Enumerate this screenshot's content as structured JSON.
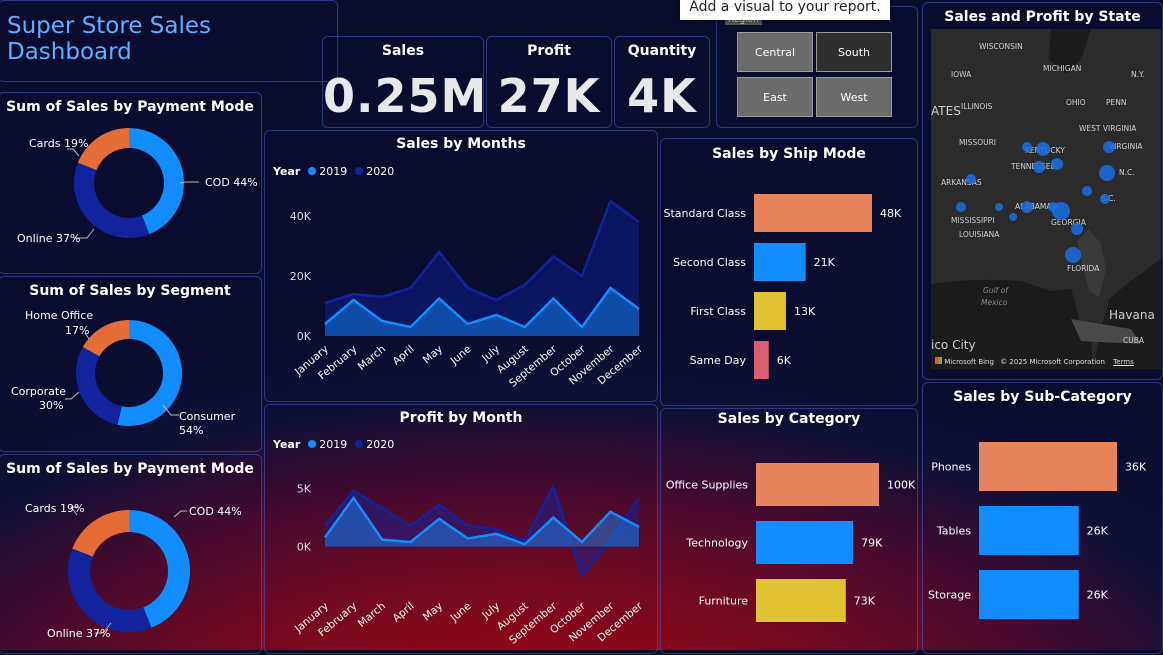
{
  "header": {
    "title": "Super Store Sales Dashboard"
  },
  "tooltip": {
    "text": "Add a visual to your report."
  },
  "kpis": {
    "sales": {
      "label": "Sales",
      "value": "0.25M"
    },
    "profit": {
      "label": "Profit",
      "value": "27K"
    },
    "quantity": {
      "label": "Quantity",
      "value": "4K"
    }
  },
  "region_slicer": {
    "title": "Region",
    "options": [
      "Central",
      "South",
      "East",
      "West"
    ],
    "selected": "South"
  },
  "payment_donut_1": {
    "title": "Sum of Sales by Payment Mode",
    "labels": [
      "Cards 19%",
      "COD 44%",
      "Online 37%"
    ]
  },
  "segment_donut": {
    "title": "Sum of Sales by Segment",
    "label_home": "Home Office",
    "label_home_pct": "17%",
    "label_corp": "Corporate",
    "label_corp_pct": "30%",
    "label_cons": "Consumer",
    "label_cons_pct": "54%"
  },
  "payment_donut_2": {
    "title": "Sum of Sales by Payment Mode",
    "labels": [
      "Cards 19%",
      "COD 44%",
      "Online 37%"
    ]
  },
  "sales_by_months": {
    "title": "Sales by Months",
    "legend_title": "Year",
    "y_ticks": [
      "40K",
      "20K",
      "0K"
    ]
  },
  "profit_by_month": {
    "title": "Profit by Month",
    "legend_title": "Year",
    "y_ticks": [
      "5K",
      "0K"
    ]
  },
  "ship_mode": {
    "title": "Sales by Ship Mode"
  },
  "category": {
    "title": "Sales by Category"
  },
  "sub_category": {
    "title": "Sales by Sub-Category"
  },
  "map": {
    "title": "Sales and Profit by State",
    "attribution": "© 2025 Microsoft Corporation",
    "terms": "Terms",
    "bing": "Microsoft Bing",
    "place_labels": [
      "WISCONSIN",
      "MICHIGAN",
      "IOWA",
      "N.Y.",
      "ILLINOIS",
      "OHIO",
      "PENN",
      "ATES",
      "MISSOURI",
      "KENTUCKY",
      "WEST VIRGINIA",
      "VIRGINIA",
      "N.C.",
      "TENNESSEE",
      "ARKANSAS",
      "S.C.",
      "MISSISSIPPI",
      "ALABAMA",
      "GEORGIA",
      "LOUISIANA",
      "FLORIDA",
      "Gulf of",
      "Mexico",
      "Havana",
      "CUBA",
      "ico City"
    ]
  },
  "chart_data": [
    {
      "type": "pie",
      "title": "Sum of Sales by Payment Mode",
      "categories": [
        "COD",
        "Online",
        "Cards"
      ],
      "values": [
        44,
        37,
        19
      ],
      "colors": [
        "#118dff",
        "#12239e",
        "#e66c37"
      ]
    },
    {
      "type": "pie",
      "title": "Sum of Sales by Segment",
      "categories": [
        "Consumer",
        "Corporate",
        "Home Office"
      ],
      "values": [
        54,
        30,
        17
      ],
      "colors": [
        "#118dff",
        "#12239e",
        "#e66c37"
      ]
    },
    {
      "type": "pie",
      "title": "Sum of Sales by Payment Mode",
      "categories": [
        "COD",
        "Online",
        "Cards"
      ],
      "values": [
        44,
        37,
        19
      ],
      "colors": [
        "#118dff",
        "#12239e",
        "#e66c37"
      ]
    },
    {
      "type": "area",
      "title": "Sales by Months",
      "categories": [
        "January",
        "February",
        "March",
        "April",
        "May",
        "June",
        "July",
        "August",
        "September",
        "October",
        "November",
        "December"
      ],
      "ylim": [
        0,
        45000
      ],
      "series": [
        {
          "name": "2019",
          "color": "#118dff",
          "values": [
            4000,
            12000,
            5000,
            3000,
            12500,
            4000,
            7000,
            3000,
            12500,
            3000,
            16000,
            9000
          ]
        },
        {
          "name": "2020",
          "color": "#12239e",
          "values": [
            11000,
            14000,
            13000,
            16000,
            28000,
            16000,
            12000,
            17000,
            26500,
            20000,
            45000,
            38000
          ]
        }
      ]
    },
    {
      "type": "area",
      "title": "Profit by Month",
      "categories": [
        "January",
        "February",
        "March",
        "April",
        "May",
        "June",
        "July",
        "August",
        "September",
        "October",
        "November",
        "December"
      ],
      "ylim": [
        -4000,
        6000
      ],
      "series": [
        {
          "name": "2019",
          "color": "#118dff",
          "values": [
            800,
            4200,
            600,
            400,
            2400,
            700,
            1100,
            200,
            2500,
            400,
            3000,
            1700
          ]
        },
        {
          "name": "2020",
          "color": "#12239e",
          "values": [
            1800,
            4800,
            3300,
            1800,
            3600,
            1800,
            1500,
            500,
            5200,
            -2500,
            500,
            4200
          ]
        }
      ]
    },
    {
      "type": "bar",
      "title": "Sales by Ship Mode",
      "categories": [
        "Standard Class",
        "Second Class",
        "First Class",
        "Same Day"
      ],
      "values": [
        48,
        21,
        13,
        6
      ],
      "labels": [
        "48K",
        "21K",
        "13K",
        "6K"
      ],
      "colors": [
        "#e8845c",
        "#118dff",
        "#e0c232",
        "#d95f6e"
      ]
    },
    {
      "type": "bar",
      "title": "Sales by Category",
      "categories": [
        "Office Supplies",
        "Technology",
        "Furniture"
      ],
      "values": [
        100,
        79,
        73
      ],
      "labels": [
        "100K",
        "79K",
        "73K"
      ],
      "colors": [
        "#e8845c",
        "#118dff",
        "#e0c232"
      ]
    },
    {
      "type": "bar",
      "title": "Sales by Sub-Category",
      "categories": [
        "Phones",
        "Tables",
        "Storage"
      ],
      "values": [
        36,
        26,
        26
      ],
      "labels": [
        "36K",
        "26K",
        "26K"
      ],
      "colors": [
        "#e8845c",
        "#118dff",
        "#118dff"
      ]
    }
  ]
}
